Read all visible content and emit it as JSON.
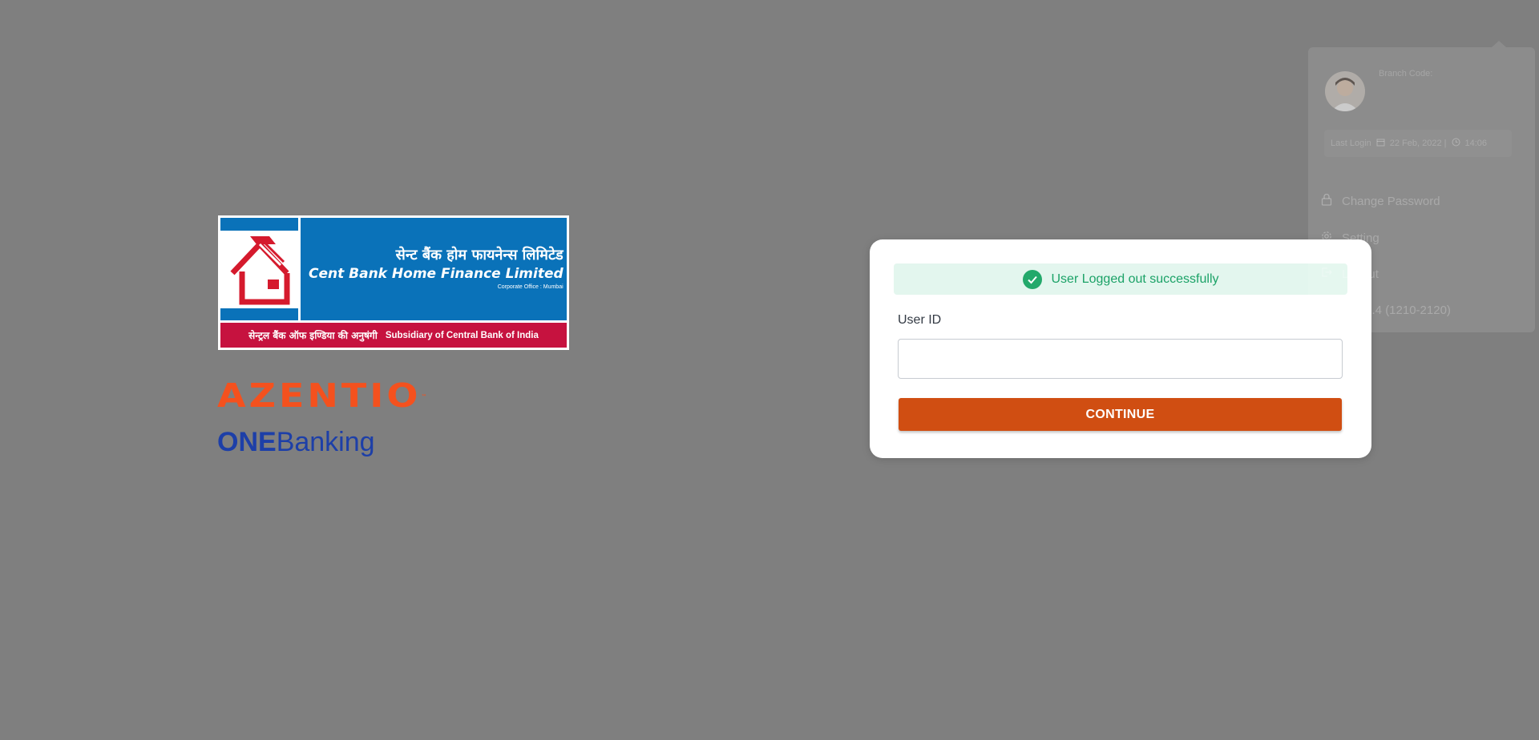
{
  "branding": {
    "cbhfl_hindi": "सेन्ट बैंक होम फायनेन्स लिमिटेड",
    "cbhfl_english": "Cent Bank Home Finance Limited",
    "cbhfl_office": "Corporate Office : Mumbai",
    "cbhfl_tagline_hindi": "सेन्ट्रल बैंक ऑफ इण्डिया की अनुषंगी",
    "cbhfl_tagline_english": "Subsidiary of Central Bank of India",
    "azentio": "AZENTIO",
    "azentio_tm": "™",
    "onebanking_one": "ONE",
    "onebanking_banking": "Banking"
  },
  "login": {
    "alert_message": "User Logged out successfully",
    "userid_label": "User ID",
    "userid_value": "",
    "userid_placeholder": "",
    "continue_label": "CONTINUE"
  },
  "profile_menu": {
    "branch_code_label": "Branch Code:",
    "last_login_label": "Last Login",
    "last_login_date": "22 Feb, 2022 |",
    "last_login_time": "14:06",
    "items": [
      {
        "label": "Change Password",
        "icon": "lock-icon"
      },
      {
        "label": "Setting",
        "icon": "gear-icon"
      },
      {
        "label": "Logout",
        "icon": "logout-icon"
      },
      {
        "label": "ver: 1.4 (1210-2120)",
        "icon": "info-icon"
      }
    ]
  },
  "colors": {
    "overlay": "#7f7f7f",
    "accent": "#d04e12",
    "success": "#23a96b",
    "cbhfl_blue": "#0a72b9",
    "cbhfl_red": "#c6123f",
    "azentio_orange": "#f4511e",
    "onebanking_blue": "#1d3fa8"
  }
}
